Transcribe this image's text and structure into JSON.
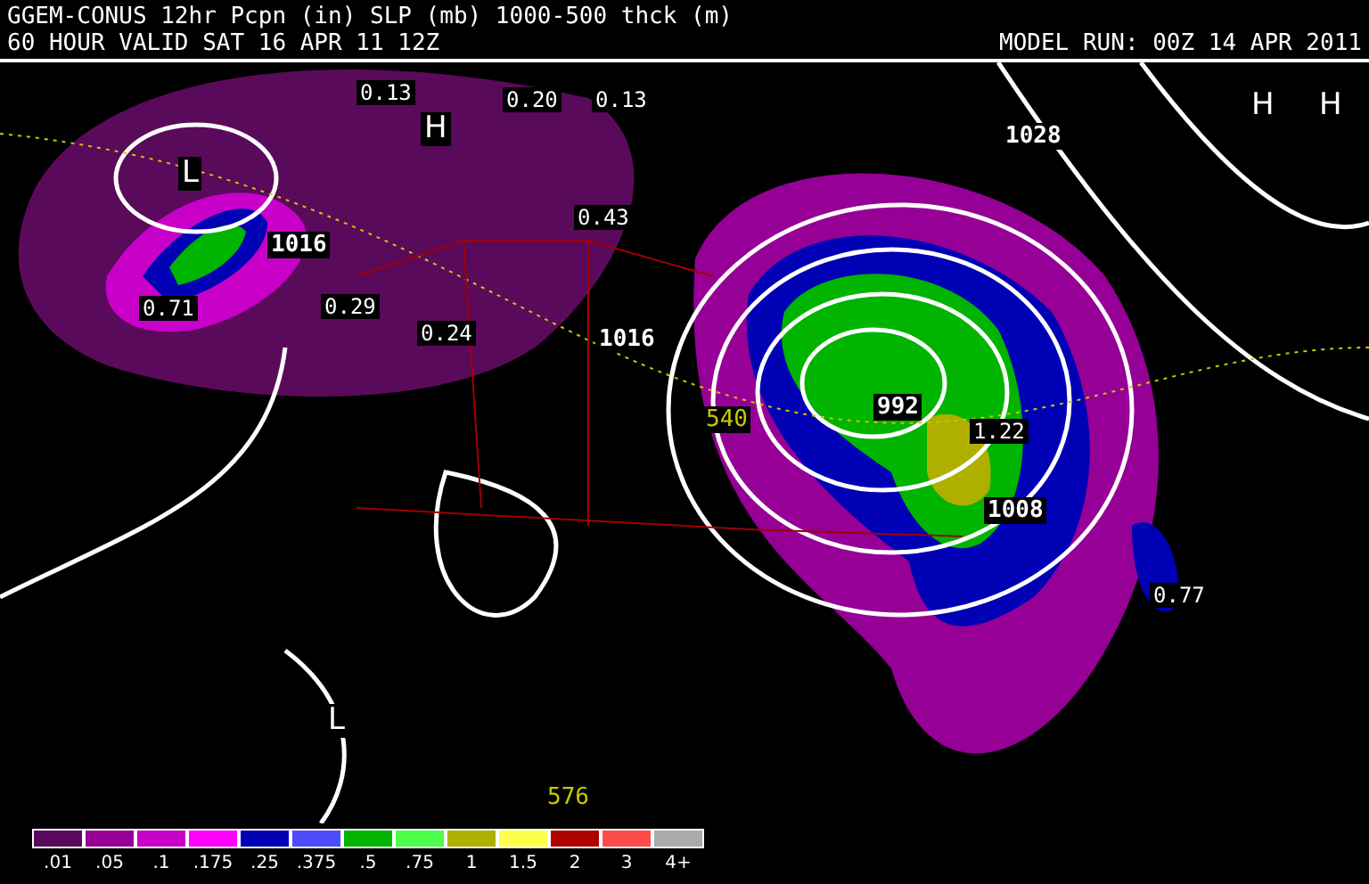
{
  "header": {
    "title": "GGEM-CONUS 12hr Pcpn (in) SLP (mb) 1000-500 thck (m)",
    "valid": "60 HOUR VALID SAT 16 APR 11 12Z",
    "model_run": "MODEL RUN: 00Z 14 APR 2011"
  },
  "map_labels": [
    {
      "kind": "precip",
      "text": "0.13"
    },
    {
      "kind": "precip",
      "text": "0.20"
    },
    {
      "kind": "precip",
      "text": "0.13"
    },
    {
      "kind": "center",
      "text": "H"
    },
    {
      "kind": "center",
      "text": "L"
    },
    {
      "kind": "pressure",
      "text": "1016"
    },
    {
      "kind": "precip",
      "text": "0.71"
    },
    {
      "kind": "precip",
      "text": "0.29"
    },
    {
      "kind": "precip",
      "text": "0.24"
    },
    {
      "kind": "precip",
      "text": "0.43"
    },
    {
      "kind": "pressure",
      "text": "1016"
    },
    {
      "kind": "pressure",
      "text": "1028"
    },
    {
      "kind": "center",
      "text": "H"
    },
    {
      "kind": "center",
      "text": "H"
    },
    {
      "kind": "pressure",
      "text": "992"
    },
    {
      "kind": "thickness",
      "text": "540"
    },
    {
      "kind": "precip",
      "text": "1.22"
    },
    {
      "kind": "pressure",
      "text": "1008"
    },
    {
      "kind": "precip",
      "text": "0.77"
    },
    {
      "kind": "center",
      "text": "L"
    },
    {
      "kind": "thickness",
      "text": "576"
    }
  ],
  "legend": [
    {
      "label": ".01",
      "color": "#5a0a5a"
    },
    {
      "label": ".05",
      "color": "#960096"
    },
    {
      "label": ".1",
      "color": "#c800c8"
    },
    {
      "label": ".175",
      "color": "#ff00ff"
    },
    {
      "label": ".25",
      "color": "#0000b4"
    },
    {
      "label": ".375",
      "color": "#4b4bff"
    },
    {
      "label": ".5",
      "color": "#00b400"
    },
    {
      "label": ".75",
      "color": "#4bff4b"
    },
    {
      "label": "1",
      "color": "#afaf00"
    },
    {
      "label": "1.5",
      "color": "#ffff4b"
    },
    {
      "label": "2",
      "color": "#af0000"
    },
    {
      "label": "3",
      "color": "#ff4b4b"
    },
    {
      "label": "4+",
      "color": "#aaaaaa"
    }
  ]
}
